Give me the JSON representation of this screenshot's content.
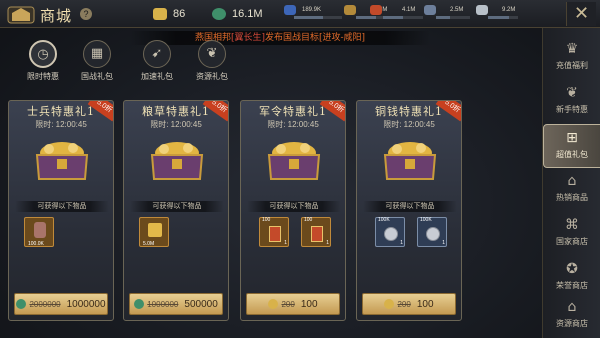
{
  "header": {
    "title": "商城",
    "help_label": "?"
  },
  "resources": [
    {
      "name": "gold",
      "value": "86",
      "color": "#d8b24a"
    },
    {
      "name": "silver",
      "value": "16.1M",
      "color": "#3f8f6a"
    },
    {
      "name": "food",
      "value": "189.9K",
      "fill": 0.6,
      "color": "#3d66b8"
    },
    {
      "name": "wood",
      "value": "5.6M",
      "fill": 0.5,
      "color": "#b38a3a"
    },
    {
      "name": "iron",
      "value": "4.1M",
      "fill": 0.5,
      "color": "#c24a2a"
    },
    {
      "name": "copper",
      "value": "2.5M",
      "fill": 0.4,
      "color": "#6d7f9b"
    },
    {
      "name": "feather",
      "value": "9.2M",
      "fill": 0.7,
      "color": "#b8c0c8"
    }
  ],
  "banner": {
    "prefix": "燕国相邦",
    "name": "[翼长生]",
    "suffix": "发布国战目标[进攻-咸阳]"
  },
  "categories": [
    {
      "label": "限时特惠",
      "icon": "clock-icon",
      "active": true
    },
    {
      "label": "国战礼包",
      "icon": "grid-icon",
      "active": false
    },
    {
      "label": "加速礼包",
      "icon": "speed-icon",
      "active": false
    },
    {
      "label": "资源礼包",
      "icon": "leaf-icon",
      "active": false
    }
  ],
  "cards": [
    {
      "title": "士兵特惠礼1",
      "tag": "5.0折",
      "time": "限时: 12:00:45",
      "strip": "可获得以下物品",
      "items": [
        {
          "top": "",
          "bottom": "100.0K",
          "count": ""
        }
      ],
      "old_price": "2000000",
      "new_price": "1000000",
      "coin": "silver"
    },
    {
      "title": "粮草特惠礼1",
      "tag": "5.0折",
      "time": "限时: 12:00:45",
      "strip": "可获得以下物品",
      "items": [
        {
          "top": "",
          "bottom": "5.0M",
          "count": ""
        }
      ],
      "old_price": "1000000",
      "new_price": "500000",
      "coin": "silver"
    },
    {
      "title": "军令特惠礼1",
      "tag": "5.0折",
      "time": "限时: 12:00:45",
      "strip": "可获得以下物品",
      "items": [
        {
          "top": "100",
          "bottom": "",
          "count": "1"
        },
        {
          "top": "100",
          "bottom": "",
          "count": "1"
        }
      ],
      "old_price": "200",
      "new_price": "100",
      "coin": "gold"
    },
    {
      "title": "铜钱特惠礼1",
      "tag": "5.0折",
      "time": "限时: 12:00:45",
      "strip": "可获得以下物品",
      "items": [
        {
          "top": "100K",
          "bottom": "",
          "count": "1"
        },
        {
          "top": "100K",
          "bottom": "",
          "count": "1"
        }
      ],
      "old_price": "200",
      "new_price": "100",
      "coin": "gold"
    }
  ],
  "sidebar": [
    {
      "label": "充值福利",
      "icon": "crown-icon",
      "active": false
    },
    {
      "label": "新手特惠",
      "icon": "leaf-icon",
      "active": false
    },
    {
      "label": "超值礼包",
      "icon": "gift-icon",
      "active": true
    },
    {
      "label": "热销商品",
      "icon": "pagoda-icon",
      "active": false
    },
    {
      "label": "国家商店",
      "icon": "building-icon",
      "active": false
    },
    {
      "label": "荣誉商店",
      "icon": "medal-icon",
      "active": false
    },
    {
      "label": "资源商店",
      "icon": "house-icon",
      "active": false
    }
  ]
}
